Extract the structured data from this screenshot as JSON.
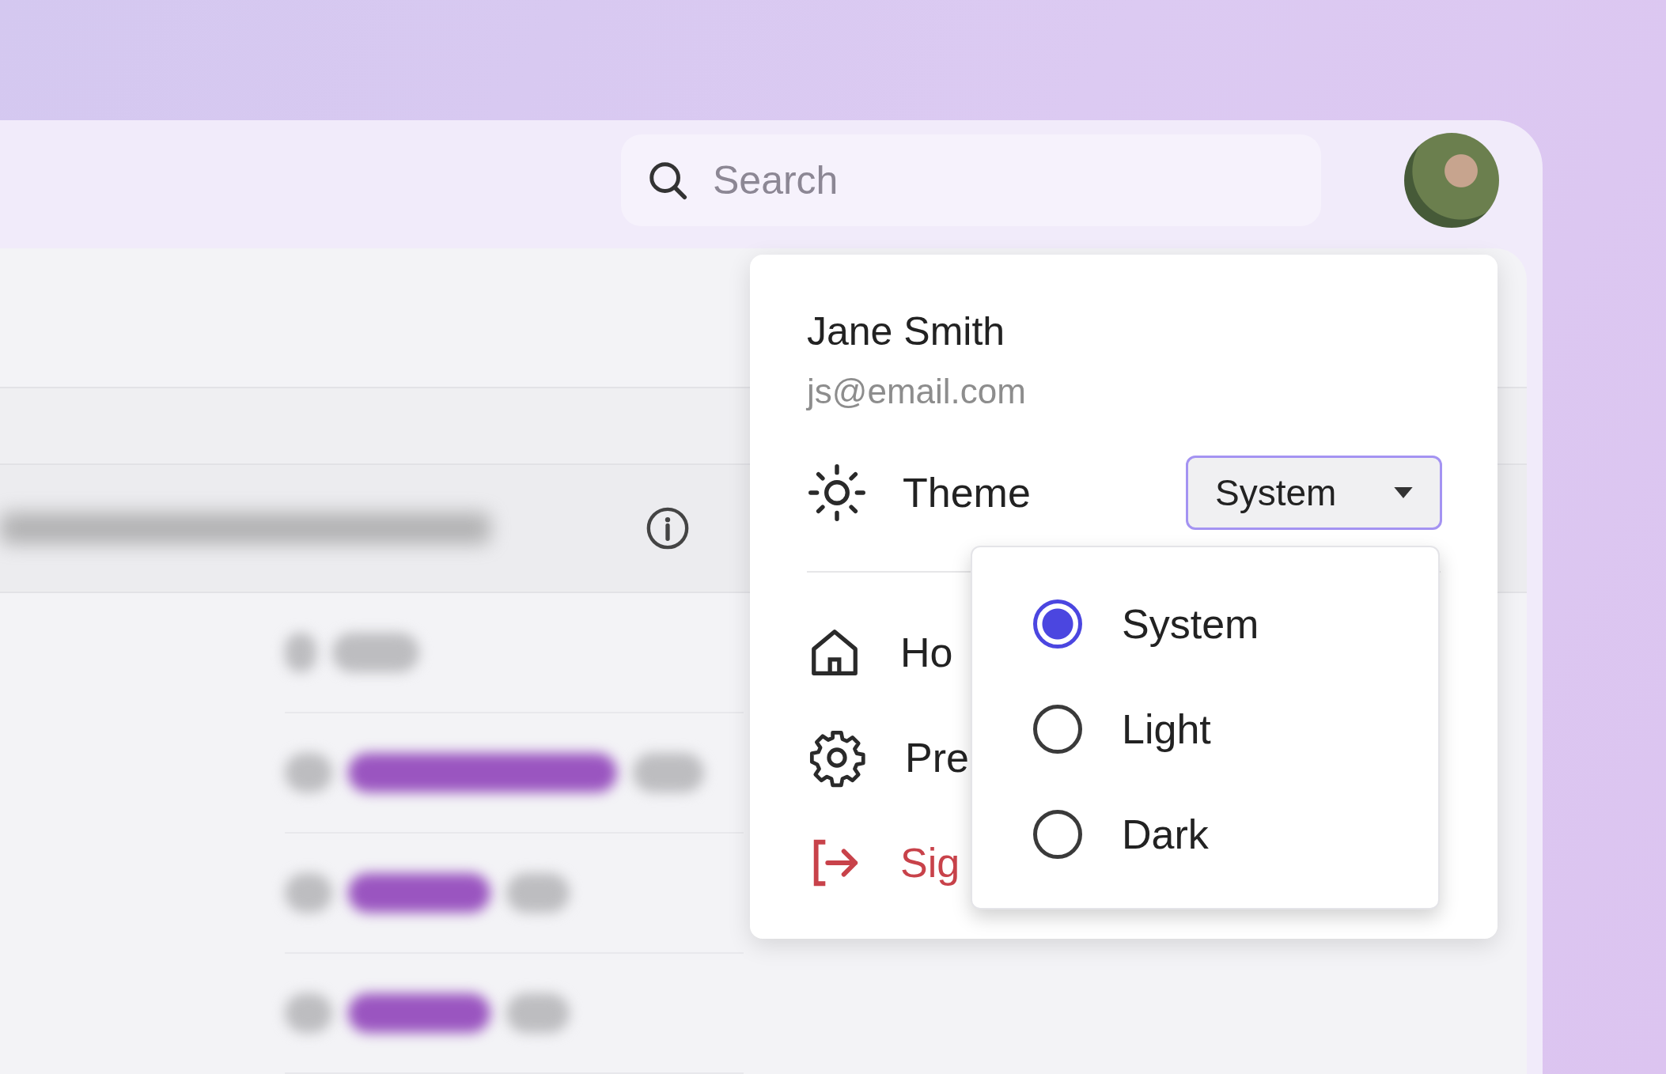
{
  "search": {
    "placeholder": "Search"
  },
  "user": {
    "name": "Jane Smith",
    "email": "js@email.com"
  },
  "theme": {
    "label": "Theme",
    "value": "System",
    "expanded": true,
    "options": [
      {
        "label": "System",
        "selected": true
      },
      {
        "label": "Light",
        "selected": false
      },
      {
        "label": "Dark",
        "selected": false
      }
    ]
  },
  "menu_items": [
    {
      "kind": "home",
      "label": "Ho"
    },
    {
      "kind": "settings",
      "label": "Pre"
    },
    {
      "kind": "sign_out",
      "label": "Sig"
    }
  ]
}
